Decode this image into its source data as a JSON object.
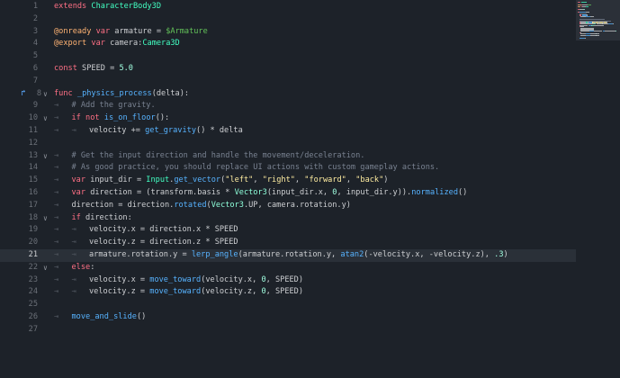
{
  "editor": {
    "current_line": 21,
    "lines": [
      {
        "n": "1",
        "indent": 0,
        "tokens": [
          [
            "kw",
            "extends"
          ],
          [
            "ident",
            " "
          ],
          [
            "cls",
            "CharacterBody3D"
          ]
        ]
      },
      {
        "n": "2",
        "indent": 0,
        "tokens": []
      },
      {
        "n": "3",
        "indent": 0,
        "tokens": [
          [
            "ann",
            "@onready"
          ],
          [
            "ident",
            " "
          ],
          [
            "kw",
            "var"
          ],
          [
            "ident",
            " armature = "
          ],
          [
            "node",
            "$Armature"
          ]
        ]
      },
      {
        "n": "4",
        "indent": 0,
        "tokens": [
          [
            "ann",
            "@export"
          ],
          [
            "ident",
            " "
          ],
          [
            "kw",
            "var"
          ],
          [
            "ident",
            " camera:"
          ],
          [
            "cls",
            "Camera3D"
          ]
        ]
      },
      {
        "n": "5",
        "indent": 0,
        "tokens": []
      },
      {
        "n": "6",
        "indent": 0,
        "tokens": [
          [
            "kw",
            "const"
          ],
          [
            "ident",
            " SPEED = "
          ],
          [
            "num",
            "5.0"
          ]
        ]
      },
      {
        "n": "7",
        "indent": 0,
        "tokens": []
      },
      {
        "n": "8",
        "indent": 0,
        "fold": true,
        "marker": true,
        "tokens": [
          [
            "kw",
            "func"
          ],
          [
            "ident",
            " "
          ],
          [
            "fn",
            "_physics_process"
          ],
          [
            "ident",
            "(delta):"
          ]
        ]
      },
      {
        "n": "9",
        "indent": 1,
        "tokens": [
          [
            "cmt",
            "# Add the gravity."
          ]
        ]
      },
      {
        "n": "10",
        "indent": 1,
        "fold": true,
        "tokens": [
          [
            "kw",
            "if"
          ],
          [
            "ident",
            " "
          ],
          [
            "kw",
            "not"
          ],
          [
            "ident",
            " "
          ],
          [
            "fn",
            "is_on_floor"
          ],
          [
            "ident",
            "():"
          ]
        ]
      },
      {
        "n": "11",
        "indent": 2,
        "tokens": [
          [
            "ident",
            "velocity += "
          ],
          [
            "fn",
            "get_gravity"
          ],
          [
            "ident",
            "() * delta"
          ]
        ]
      },
      {
        "n": "12",
        "indent": 0,
        "tokens": []
      },
      {
        "n": "13",
        "indent": 1,
        "fold": true,
        "tokens": [
          [
            "cmt",
            "# Get the input direction and handle the movement/deceleration."
          ]
        ]
      },
      {
        "n": "14",
        "indent": 1,
        "tokens": [
          [
            "cmt",
            "# As good practice, you should replace UI actions with custom gameplay actions."
          ]
        ]
      },
      {
        "n": "15",
        "indent": 1,
        "tokens": [
          [
            "kw",
            "var"
          ],
          [
            "ident",
            " input_dir = "
          ],
          [
            "cls",
            "Input"
          ],
          [
            "ident",
            "."
          ],
          [
            "fn",
            "get_vector"
          ],
          [
            "ident",
            "("
          ],
          [
            "str",
            "\"left\""
          ],
          [
            "ident",
            ", "
          ],
          [
            "str",
            "\"right\""
          ],
          [
            "ident",
            ", "
          ],
          [
            "str",
            "\"forward\""
          ],
          [
            "ident",
            ", "
          ],
          [
            "str",
            "\"back\""
          ],
          [
            "ident",
            ")"
          ]
        ]
      },
      {
        "n": "16",
        "indent": 1,
        "tokens": [
          [
            "kw",
            "var"
          ],
          [
            "ident",
            " direction = (transform.basis * "
          ],
          [
            "typ",
            "Vector3"
          ],
          [
            "ident",
            "(input_dir.x, "
          ],
          [
            "num",
            "0"
          ],
          [
            "ident",
            ", input_dir.y))."
          ],
          [
            "fn",
            "normalized"
          ],
          [
            "ident",
            "()"
          ]
        ]
      },
      {
        "n": "17",
        "indent": 1,
        "tokens": [
          [
            "ident",
            "direction = direction."
          ],
          [
            "fn",
            "rotated"
          ],
          [
            "ident",
            "("
          ],
          [
            "typ",
            "Vector3"
          ],
          [
            "ident",
            ".UP, camera.rotation.y)"
          ]
        ]
      },
      {
        "n": "18",
        "indent": 1,
        "fold": true,
        "tokens": [
          [
            "kw",
            "if"
          ],
          [
            "ident",
            " direction:"
          ]
        ]
      },
      {
        "n": "19",
        "indent": 2,
        "tokens": [
          [
            "ident",
            "velocity.x = direction.x * SPEED"
          ]
        ]
      },
      {
        "n": "20",
        "indent": 2,
        "tokens": [
          [
            "ident",
            "velocity.z = direction.z * SPEED"
          ]
        ]
      },
      {
        "n": "21",
        "indent": 2,
        "tokens": [
          [
            "ident",
            "armature.rotation.y = "
          ],
          [
            "fn",
            "lerp_angle"
          ],
          [
            "ident",
            "(armature.rotation.y, "
          ],
          [
            "fn",
            "atan2"
          ],
          [
            "ident",
            "(-velocity.x, -velocity.z), "
          ],
          [
            "num",
            ".3"
          ],
          [
            "ident",
            ")"
          ]
        ]
      },
      {
        "n": "22",
        "indent": 1,
        "fold": true,
        "tokens": [
          [
            "kw",
            "else"
          ],
          [
            "ident",
            ":"
          ]
        ]
      },
      {
        "n": "23",
        "indent": 2,
        "tokens": [
          [
            "ident",
            "velocity.x = "
          ],
          [
            "fn",
            "move_toward"
          ],
          [
            "ident",
            "(velocity.x, "
          ],
          [
            "num",
            "0"
          ],
          [
            "ident",
            ", SPEED)"
          ]
        ]
      },
      {
        "n": "24",
        "indent": 2,
        "tokens": [
          [
            "ident",
            "velocity.z = "
          ],
          [
            "fn",
            "move_toward"
          ],
          [
            "ident",
            "(velocity.z, "
          ],
          [
            "num",
            "0"
          ],
          [
            "ident",
            ", SPEED)"
          ]
        ]
      },
      {
        "n": "25",
        "indent": 0,
        "tokens": []
      },
      {
        "n": "26",
        "indent": 1,
        "tokens": [
          [
            "fn",
            "move_and_slide"
          ],
          [
            "ident",
            "()"
          ]
        ]
      },
      {
        "n": "27",
        "indent": 0,
        "tokens": []
      }
    ]
  },
  "icons": {
    "fold": "chevron-down-icon",
    "marker": "override-method-icon",
    "tab": "tab-indent-icon"
  },
  "colors": {
    "background": "#1d2229",
    "keyword": "#ff7085",
    "class": "#42ffc2",
    "function": "#57b3ff",
    "string": "#ffeda1",
    "comment": "#798291",
    "annotation": "#ffb373"
  }
}
